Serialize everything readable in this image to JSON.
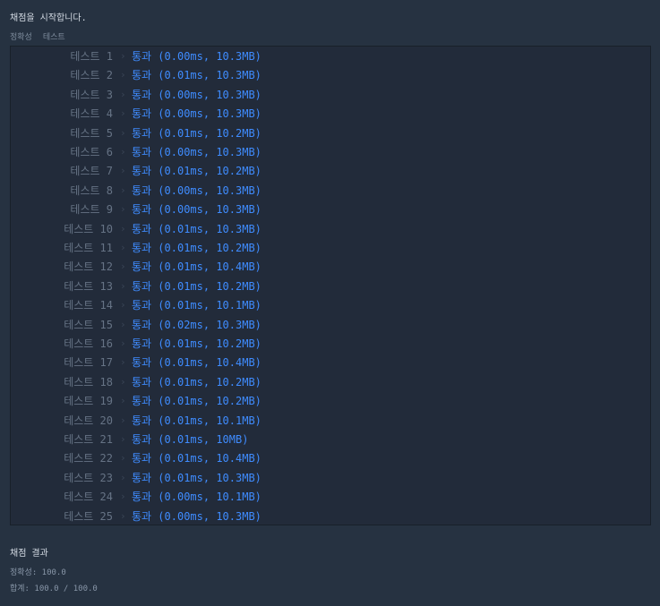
{
  "start_message": "채점을 시작합니다.",
  "section_header": {
    "category": "정확성",
    "subcategory": "테스트"
  },
  "tests": [
    {
      "label": "테스트 1",
      "result": "통과 (0.00ms, 10.3MB)"
    },
    {
      "label": "테스트 2",
      "result": "통과 (0.01ms, 10.3MB)"
    },
    {
      "label": "테스트 3",
      "result": "통과 (0.00ms, 10.3MB)"
    },
    {
      "label": "테스트 4",
      "result": "통과 (0.00ms, 10.3MB)"
    },
    {
      "label": "테스트 5",
      "result": "통과 (0.01ms, 10.2MB)"
    },
    {
      "label": "테스트 6",
      "result": "통과 (0.00ms, 10.3MB)"
    },
    {
      "label": "테스트 7",
      "result": "통과 (0.01ms, 10.2MB)"
    },
    {
      "label": "테스트 8",
      "result": "통과 (0.00ms, 10.3MB)"
    },
    {
      "label": "테스트 9",
      "result": "통과 (0.00ms, 10.3MB)"
    },
    {
      "label": "테스트 10",
      "result": "통과 (0.01ms, 10.3MB)"
    },
    {
      "label": "테스트 11",
      "result": "통과 (0.01ms, 10.2MB)"
    },
    {
      "label": "테스트 12",
      "result": "통과 (0.01ms, 10.4MB)"
    },
    {
      "label": "테스트 13",
      "result": "통과 (0.01ms, 10.2MB)"
    },
    {
      "label": "테스트 14",
      "result": "통과 (0.01ms, 10.1MB)"
    },
    {
      "label": "테스트 15",
      "result": "통과 (0.02ms, 10.3MB)"
    },
    {
      "label": "테스트 16",
      "result": "통과 (0.01ms, 10.2MB)"
    },
    {
      "label": "테스트 17",
      "result": "통과 (0.01ms, 10.4MB)"
    },
    {
      "label": "테스트 18",
      "result": "통과 (0.01ms, 10.2MB)"
    },
    {
      "label": "테스트 19",
      "result": "통과 (0.01ms, 10.2MB)"
    },
    {
      "label": "테스트 20",
      "result": "통과 (0.01ms, 10.1MB)"
    },
    {
      "label": "테스트 21",
      "result": "통과 (0.01ms, 10MB)"
    },
    {
      "label": "테스트 22",
      "result": "통과 (0.01ms, 10.4MB)"
    },
    {
      "label": "테스트 23",
      "result": "통과 (0.01ms, 10.3MB)"
    },
    {
      "label": "테스트 24",
      "result": "통과 (0.00ms, 10.1MB)"
    },
    {
      "label": "테스트 25",
      "result": "통과 (0.00ms, 10.3MB)"
    }
  ],
  "result_title": "채점 결과",
  "accuracy_line": "정확성: 100.0",
  "total_line": "합계: 100.0 / 100.0",
  "colors": {
    "background": "#263241",
    "panel": "#222b3a",
    "pass": "#3f8cff",
    "label": "#667385"
  }
}
